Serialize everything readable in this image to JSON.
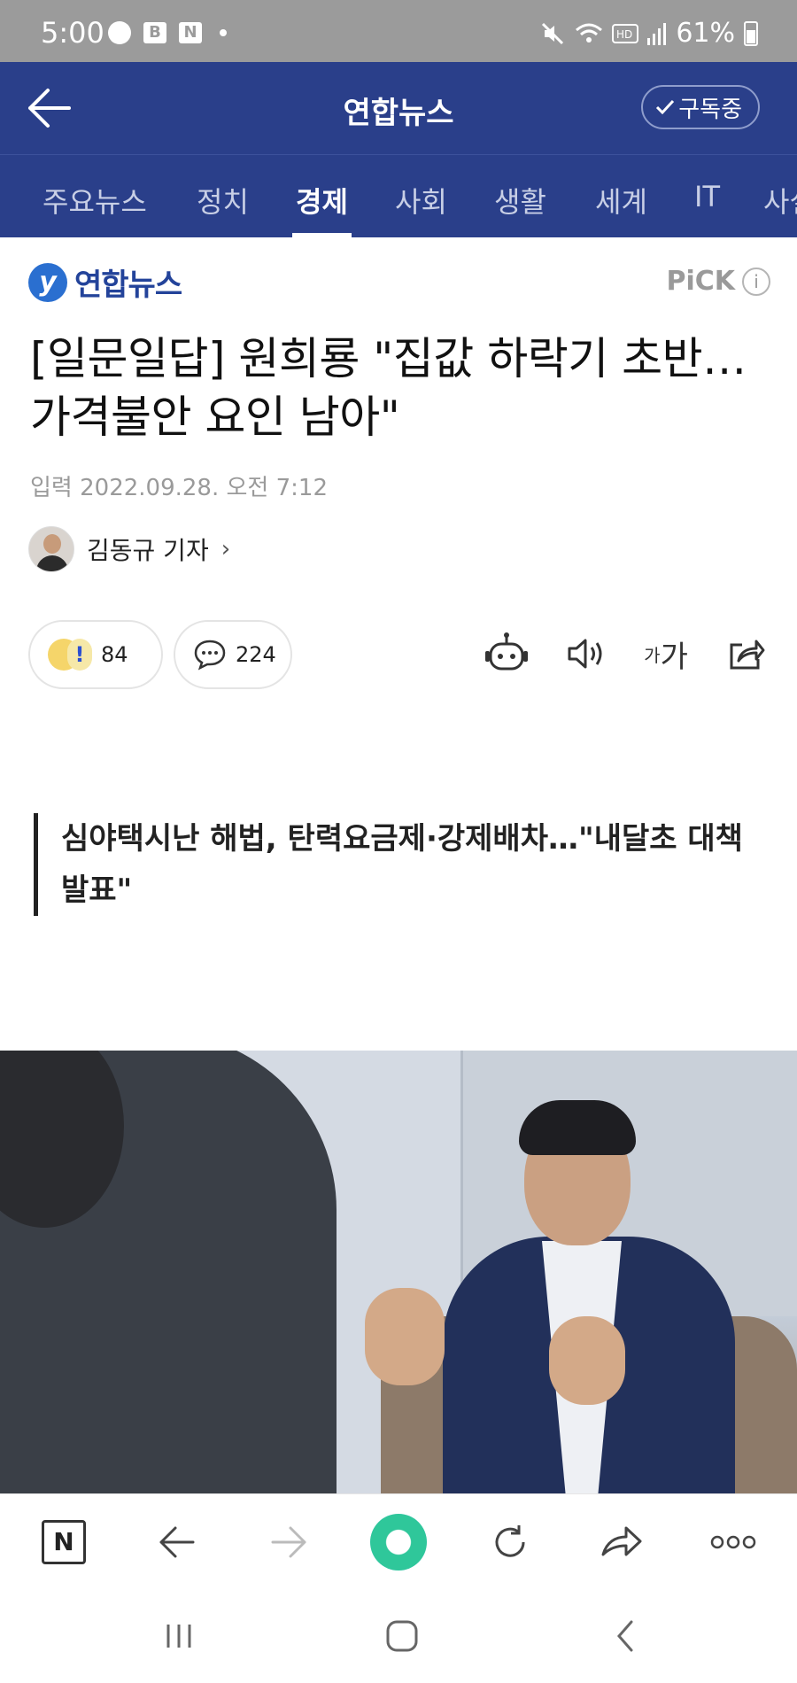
{
  "status_bar": {
    "time": "5:00",
    "notif_b": "B",
    "notif_n": "N",
    "battery_pct": "61%",
    "battery_level": 0.61
  },
  "header": {
    "title": "연합뉴스",
    "subscribe_label": "구독중"
  },
  "tabs": [
    {
      "label": "주요뉴스",
      "active": false
    },
    {
      "label": "정치",
      "active": false
    },
    {
      "label": "경제",
      "active": true
    },
    {
      "label": "사회",
      "active": false
    },
    {
      "label": "생활",
      "active": false
    },
    {
      "label": "세계",
      "active": false
    },
    {
      "label": "IT",
      "active": false
    },
    {
      "label": "사설",
      "active": false
    }
  ],
  "article": {
    "press_name": "연합뉴스",
    "pick_label": "PiCK",
    "headline": "[일문일답] 원희룡 \"집값 하락기 초반…가격불안 요인 남아\"",
    "date": "입력 2022.09.28. 오전 7:12",
    "reporter": "김동규 기자",
    "reaction_count": "84",
    "comment_count": "224",
    "font_label_small": "가",
    "font_label_large": "가",
    "quote": "심야택시난 해법, 탄력요금제·강제배차…\"내달초 대책발표\""
  },
  "browser_bar": {
    "n_label": "N"
  },
  "colors": {
    "header_bg": "#2a3f8a",
    "status_bg": "#9b9b9b",
    "press_blue": "#23439a"
  }
}
